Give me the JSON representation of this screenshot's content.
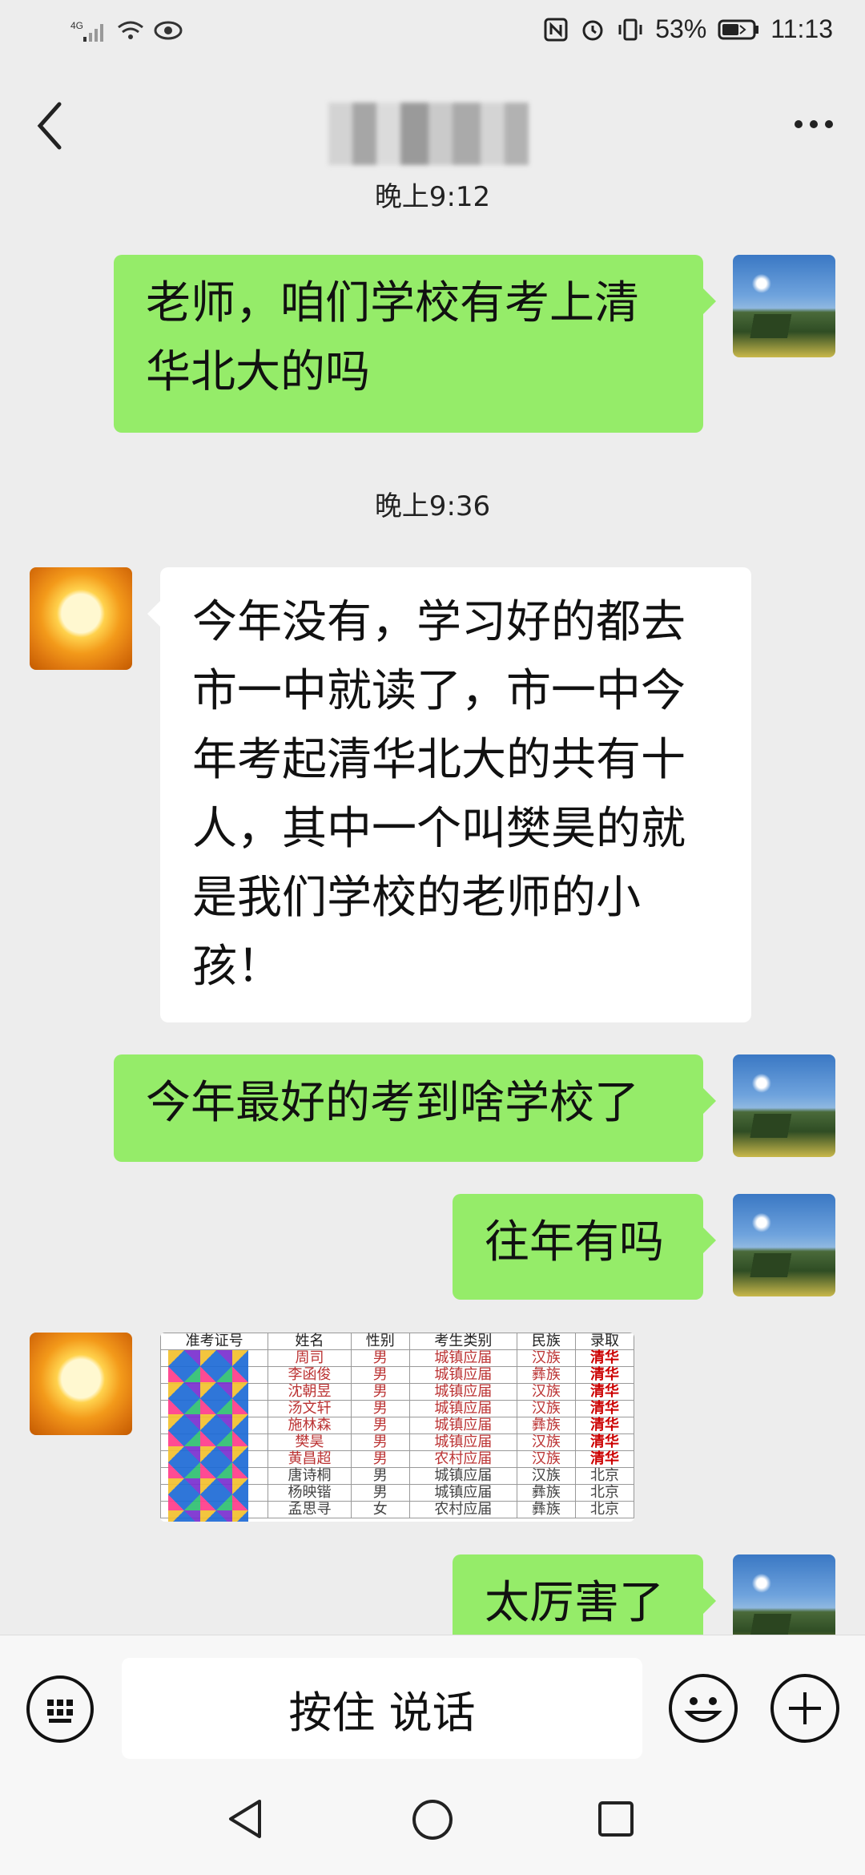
{
  "status_bar": {
    "network": "4G",
    "battery": "53%",
    "time": "11:13"
  },
  "nav": {
    "title_obscured": true
  },
  "messages": [
    {
      "type": "time",
      "text": "晚上9:12"
    },
    {
      "type": "text",
      "sender": "me",
      "text": "老师，咱们学校有考上清华北大的吗"
    },
    {
      "type": "time",
      "text": "晚上9:36"
    },
    {
      "type": "text",
      "sender": "other",
      "text": "今年没有，学习好的都去市一中就读了，市一中今年考起清华北大的共有十人，其中一个叫樊昊的就是我们学校的老师的小孩！"
    },
    {
      "type": "text",
      "sender": "me",
      "text": "今年最好的考到啥学校了"
    },
    {
      "type": "text",
      "sender": "me",
      "text": "往年有吗"
    },
    {
      "type": "image",
      "sender": "other"
    },
    {
      "type": "text",
      "sender": "me",
      "text": "太厉害了"
    }
  ],
  "image_table": {
    "headers": [
      "准考证号",
      "姓名",
      "性别",
      "考生类别",
      "民族",
      "录取"
    ],
    "rows": [
      [
        "",
        "周司",
        "男",
        "城镇应届",
        "汉族",
        "清华"
      ],
      [
        "",
        "李函俊",
        "男",
        "城镇应届",
        "彝族",
        "清华"
      ],
      [
        "",
        "沈朝昱",
        "男",
        "城镇应届",
        "汉族",
        "清华"
      ],
      [
        "",
        "汤文轩",
        "男",
        "城镇应届",
        "汉族",
        "清华"
      ],
      [
        "",
        "施林森",
        "男",
        "城镇应届",
        "彝族",
        "清华"
      ],
      [
        "",
        "樊昊",
        "男",
        "城镇应届",
        "汉族",
        "清华"
      ],
      [
        "",
        "黄昌超",
        "男",
        "农村应届",
        "汉族",
        "清华"
      ],
      [
        "",
        "唐诗桐",
        "男",
        "城镇应届",
        "汉族",
        "北京"
      ],
      [
        "",
        "杨映锴",
        "男",
        "城镇应届",
        "彝族",
        "北京"
      ],
      [
        "",
        "孟思寻",
        "女",
        "农村应届",
        "彝族",
        "北京"
      ]
    ]
  },
  "input": {
    "voice_label": "按住 说话"
  }
}
